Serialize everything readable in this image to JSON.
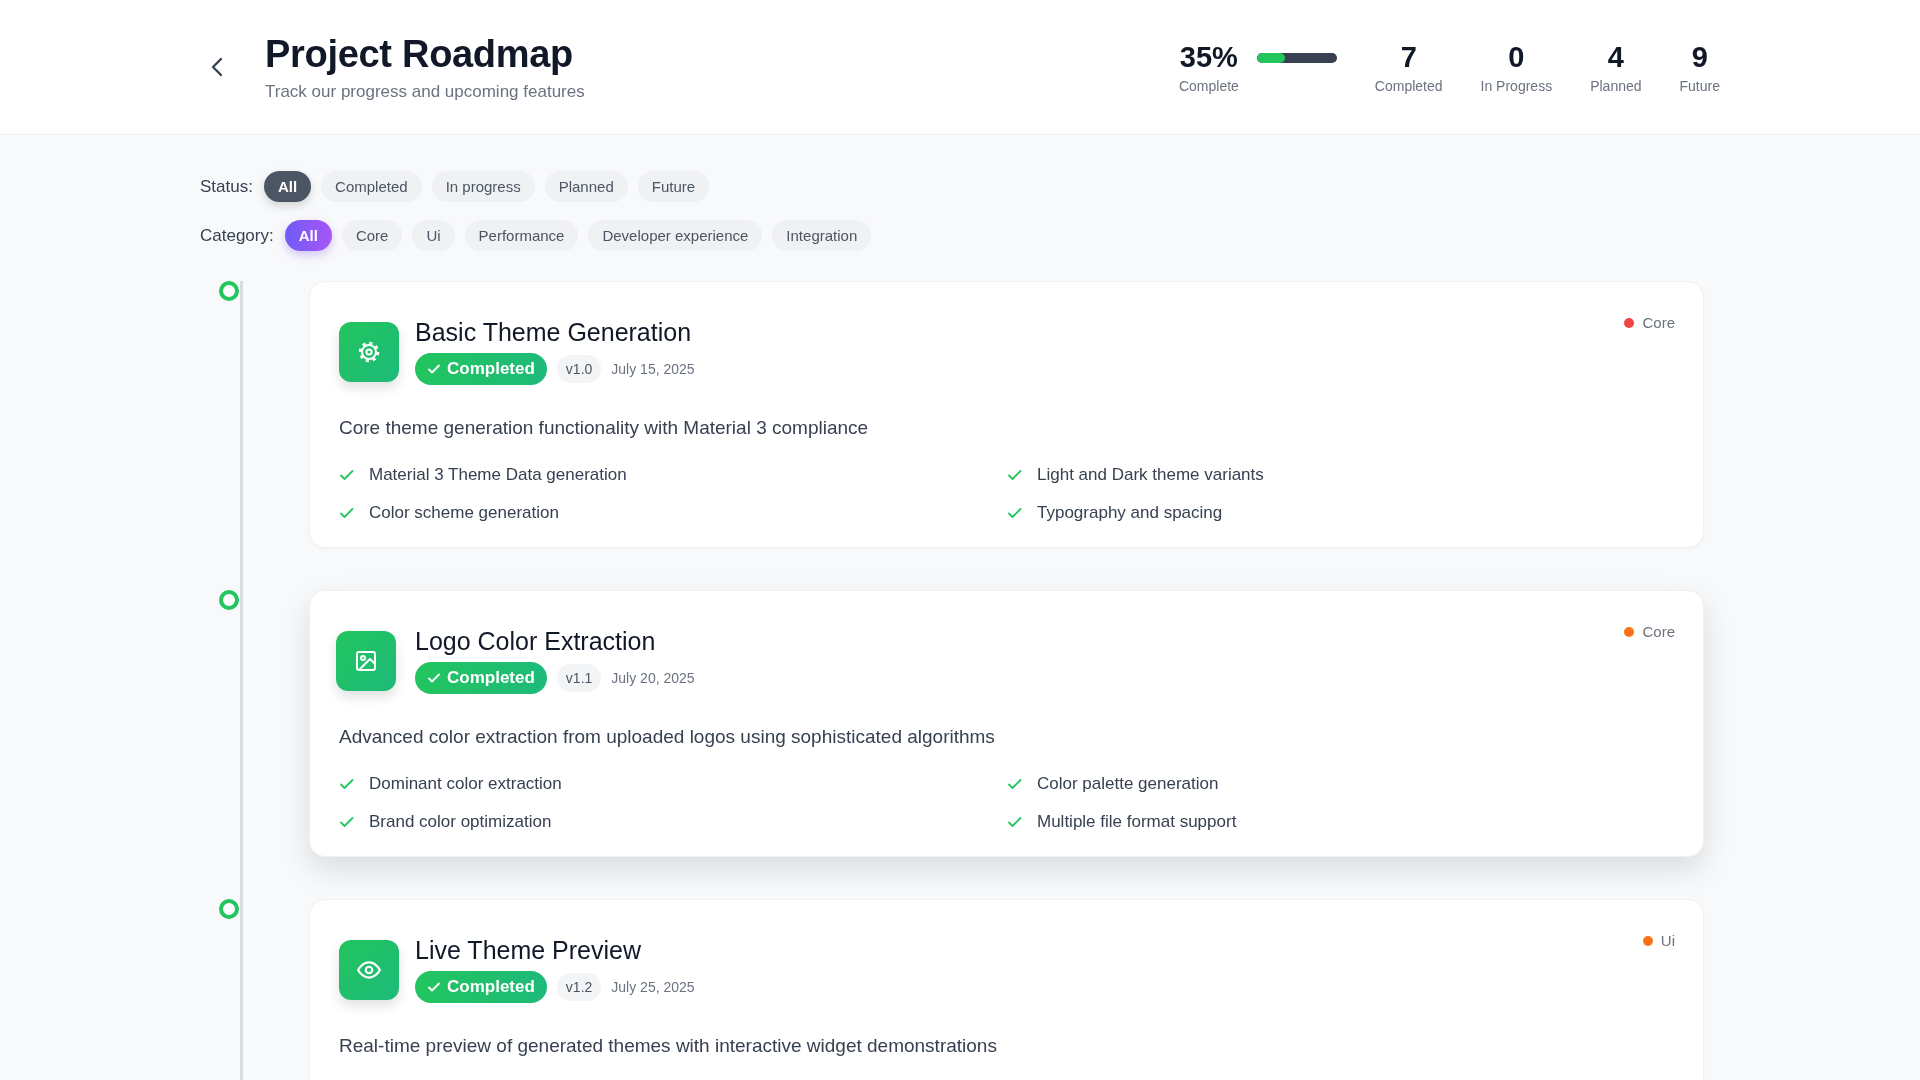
{
  "header": {
    "title": "Project Roadmap",
    "subtitle": "Track our progress and upcoming features"
  },
  "progress": {
    "value": "35%",
    "label": "Complete",
    "level": 0.35
  },
  "stats": [
    {
      "value": "7",
      "label": "Completed"
    },
    {
      "value": "0",
      "label": "In Progress"
    },
    {
      "value": "4",
      "label": "Planned"
    },
    {
      "value": "9",
      "label": "Future"
    }
  ],
  "filters": [
    {
      "label": "Status:",
      "kind": "status",
      "options": [
        {
          "label": "All",
          "selected": true
        },
        {
          "label": "Completed",
          "selected": false
        },
        {
          "label": "In progress",
          "selected": false
        },
        {
          "label": "Planned",
          "selected": false
        },
        {
          "label": "Future",
          "selected": false
        }
      ]
    },
    {
      "label": "Category:",
      "kind": "category",
      "options": [
        {
          "label": "All",
          "selected": true
        },
        {
          "label": "Core",
          "selected": false
        },
        {
          "label": "Ui",
          "selected": false
        },
        {
          "label": "Performance",
          "selected": false
        },
        {
          "label": "Developer experience",
          "selected": false
        },
        {
          "label": "Integration",
          "selected": false
        }
      ]
    }
  ],
  "items": [
    {
      "kind": "gear",
      "title": "Basic Theme Generation",
      "status": "Completed",
      "version": "v1.0",
      "date": "July 15, 2025",
      "category": "Core",
      "color": "#ef4444",
      "hovered": false,
      "description": "Core theme generation functionality with Material 3 compliance",
      "features": [
        "Material 3 Theme Data generation",
        "Light and Dark theme variants",
        "Color scheme generation",
        "Typography and spacing"
      ]
    },
    {
      "kind": "image",
      "title": "Logo Color Extraction",
      "status": "Completed",
      "version": "v1.1",
      "date": "July 20, 2025",
      "category": "Core",
      "color": "#f97316",
      "hovered": true,
      "description": "Advanced color extraction from uploaded logos using sophisticated algorithms",
      "features": [
        "Dominant color extraction",
        "Color palette generation",
        "Brand color optimization",
        "Multiple file format support"
      ]
    },
    {
      "kind": "eye",
      "title": "Live Theme Preview",
      "status": "Completed",
      "version": "v1.2",
      "date": "July 25, 2025",
      "category": "Ui",
      "color": "#f97316",
      "hovered": false,
      "description": "Real-time preview of generated themes with interactive widget demonstrations"
    }
  ]
}
